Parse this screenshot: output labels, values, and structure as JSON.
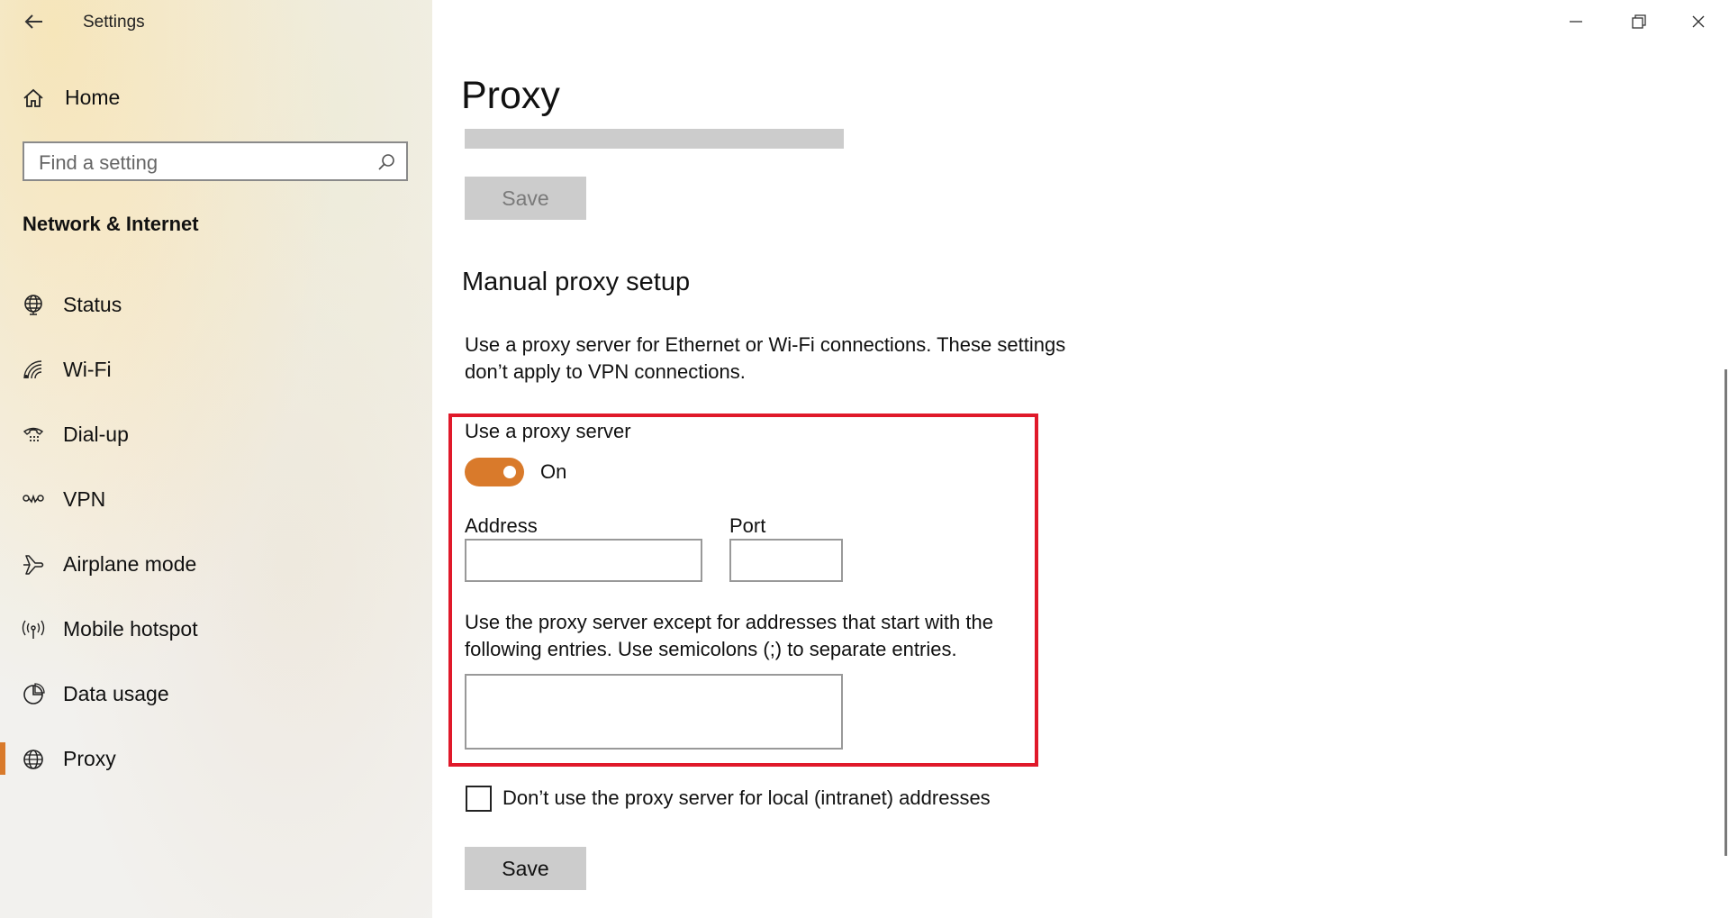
{
  "window": {
    "title": "Settings"
  },
  "sidebar": {
    "home_label": "Home",
    "search_placeholder": "Find a setting",
    "section_title": "Network & Internet",
    "items": [
      {
        "label": "Status",
        "icon": "globe-network-icon"
      },
      {
        "label": "Wi-Fi",
        "icon": "wifi-icon"
      },
      {
        "label": "Dial-up",
        "icon": "dialup-phone-icon"
      },
      {
        "label": "VPN",
        "icon": "vpn-icon"
      },
      {
        "label": "Airplane mode",
        "icon": "airplane-icon"
      },
      {
        "label": "Mobile hotspot",
        "icon": "hotspot-icon"
      },
      {
        "label": "Data usage",
        "icon": "data-usage-icon"
      },
      {
        "label": "Proxy",
        "icon": "globe-icon",
        "selected": true
      }
    ]
  },
  "main": {
    "page_title": "Proxy",
    "top_save_label": "Save",
    "manual_heading": "Manual proxy setup",
    "manual_description": "Use a proxy server for Ethernet or Wi-Fi connections. These settings don’t apply to VPN connections.",
    "use_proxy_label": "Use a proxy server",
    "toggle_state": "On",
    "address_label": "Address",
    "address_value": "",
    "port_label": "Port",
    "port_value": "",
    "exceptions_description": "Use the proxy server except for addresses that start with the following entries. Use semicolons (;) to separate entries.",
    "exceptions_value": "",
    "local_checkbox_label": "Don’t use the proxy server for local (intranet) addresses",
    "local_checkbox_checked": false,
    "bottom_save_label": "Save"
  },
  "colors": {
    "accent": "#d97a2b",
    "highlight_border": "#e0192a",
    "button_bg": "#cccccc"
  }
}
